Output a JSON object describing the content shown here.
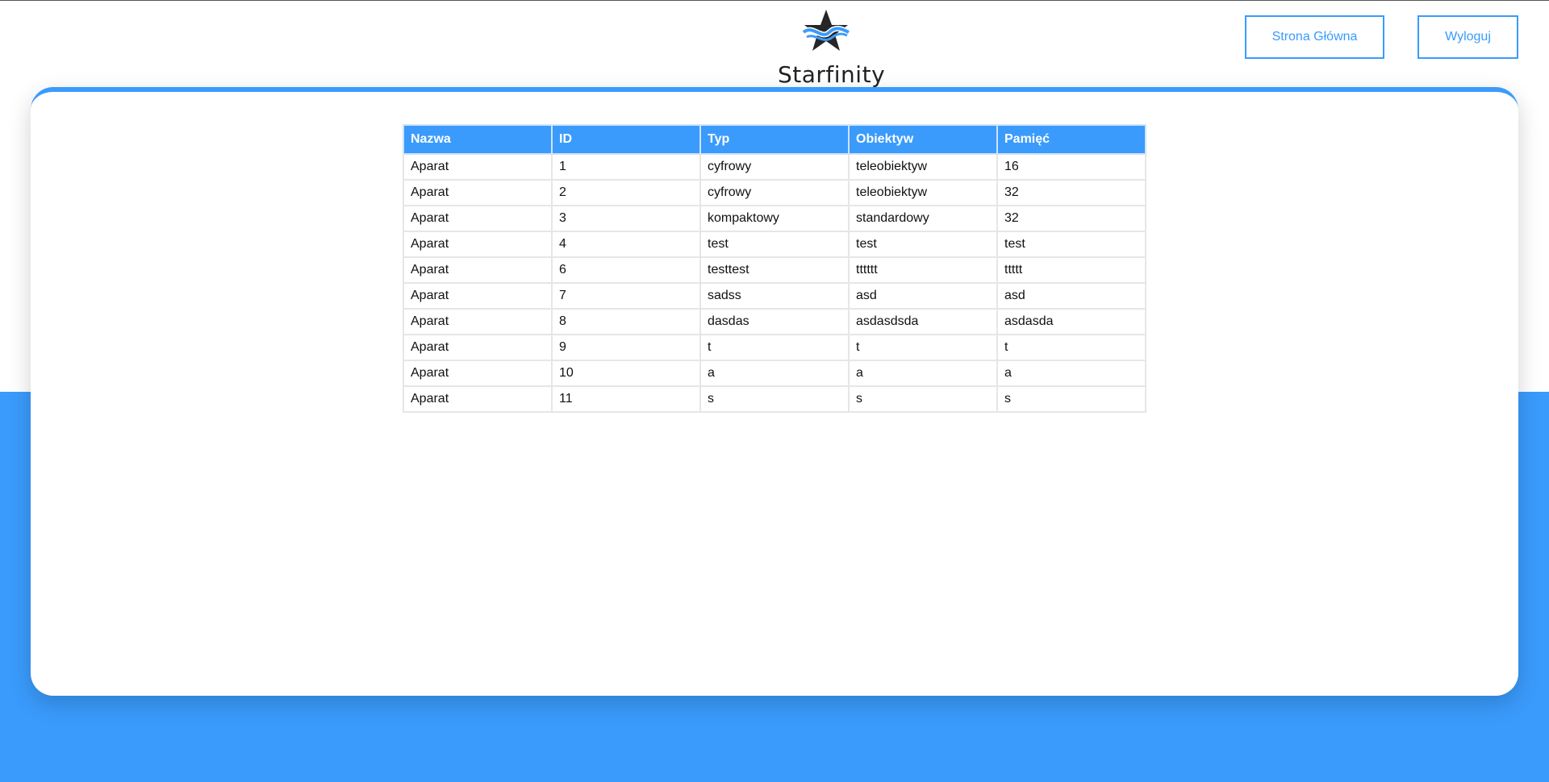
{
  "header": {
    "brand": "Starfinity",
    "logo_icon": "star-wave-logo-icon",
    "nav": {
      "home_label": "Strona Główna",
      "logout_label": "Wyloguj"
    }
  },
  "colors": {
    "accent": "#3a9bfc",
    "text": "#111111"
  },
  "table": {
    "headers": [
      "Nazwa",
      "ID",
      "Typ",
      "Obiektyw",
      "Pamięć"
    ],
    "rows": [
      [
        "Aparat",
        "1",
        "cyfrowy",
        "teleobiektyw",
        "16"
      ],
      [
        "Aparat",
        "2",
        "cyfrowy",
        "teleobiektyw",
        "32"
      ],
      [
        "Aparat",
        "3",
        "kompaktowy",
        "standardowy",
        "32"
      ],
      [
        "Aparat",
        "4",
        "test",
        "test",
        "test"
      ],
      [
        "Aparat",
        "6",
        "testtest",
        "tttttt",
        "ttttt"
      ],
      [
        "Aparat",
        "7",
        "sadss",
        "asd",
        "asd"
      ],
      [
        "Aparat",
        "8",
        "dasdas",
        "asdasdsda",
        "asdasda"
      ],
      [
        "Aparat",
        "9",
        "t",
        "t",
        "t"
      ],
      [
        "Aparat",
        "10",
        "a",
        "a",
        "a"
      ],
      [
        "Aparat",
        "11",
        "s",
        "s",
        "s"
      ]
    ]
  }
}
